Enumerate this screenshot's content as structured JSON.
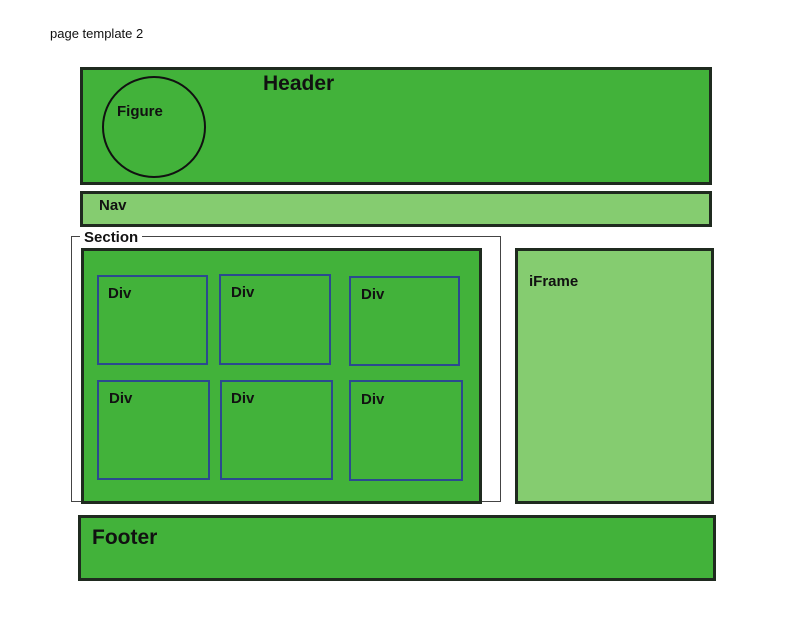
{
  "caption": "page template 2",
  "header": {
    "label": "Header"
  },
  "figure": {
    "label": "Figure"
  },
  "nav": {
    "label": "Nav"
  },
  "section": {
    "label": "Section",
    "divs": [
      "Div",
      "Div",
      "Div",
      "Div",
      "Div",
      "Div"
    ]
  },
  "iframe": {
    "label": "iFrame"
  },
  "footer": {
    "label": "Footer"
  },
  "colors": {
    "dark_green": "#42b23a",
    "light_green": "#85cc70",
    "div_border": "#2b4a8f"
  }
}
